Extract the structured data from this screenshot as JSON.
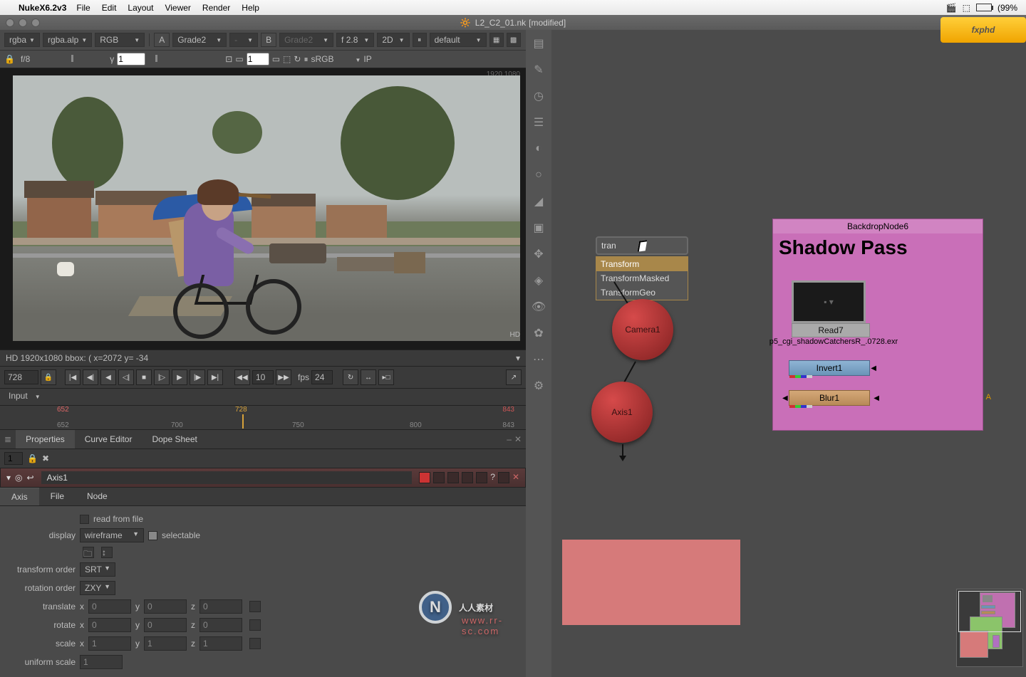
{
  "menubar": {
    "appname": "NukeX6.2v3",
    "items": [
      "File",
      "Edit",
      "Layout",
      "Viewer",
      "Render",
      "Help"
    ],
    "battery_pct": "(99%"
  },
  "titlebar": {
    "filename": "L2_C2_01.nk",
    "suffix": "[modified]"
  },
  "toolbar1": {
    "channel1": "rgba",
    "channel2": "rgba.alp",
    "rgb": "RGB",
    "a_label": "A",
    "a_value": "Grade2",
    "b_label": "B",
    "b_value": "Grade2",
    "proxy": "f 2.8",
    "dim": "2D",
    "d_value": "default"
  },
  "toolbar2": {
    "fstop_label": "f/8",
    "fstop_val": "",
    "gamma_label": "γ",
    "gamma_val": "1",
    "mid_val": "1",
    "colorspace": "sRGB",
    "ip": "IP"
  },
  "viewer": {
    "res_overlay": "1920,1080",
    "hd_overlay": "HD"
  },
  "statusbar": {
    "text": "HD 1920x1080 bbox: (  x=2072 y= -34"
  },
  "transport": {
    "frame": "728",
    "step": "10",
    "fps_label": "fps",
    "fps": "24",
    "input_dd": "Input"
  },
  "timeline": {
    "start": "652",
    "start_red": "652",
    "ticks": [
      "700",
      "750",
      "800"
    ],
    "cur": "728",
    "end": "843",
    "end_red": "843"
  },
  "proptabs": {
    "tabs": [
      "Properties",
      "Curve Editor",
      "Dope Sheet"
    ]
  },
  "propstrip": {
    "value": "1"
  },
  "nodepanel": {
    "title": "Axis1",
    "tabs": [
      "Axis",
      "File",
      "Node"
    ],
    "read_from_file": "read from file",
    "display_label": "display",
    "display_val": "wireframe",
    "selectable": "selectable",
    "transform_order_label": "transform order",
    "transform_order": "SRT",
    "rotation_order_label": "rotation order",
    "rotation_order": "ZXY",
    "translate_label": "translate",
    "rotate_label": "rotate",
    "scale_label": "scale",
    "uniform_scale_label": "uniform scale",
    "x": "x",
    "y": "y",
    "z": "z",
    "t_x": "0",
    "t_y": "0",
    "t_z": "0",
    "r_x": "0",
    "r_y": "0",
    "r_z": "0",
    "s_x": "1",
    "s_y": "1",
    "s_z": "1",
    "us": "1"
  },
  "tabpopup": {
    "query": "tran",
    "options": [
      "Transform",
      "TransformMasked",
      "TransformGeo"
    ]
  },
  "nodes": {
    "camera": "Camera1",
    "axis": "Axis1"
  },
  "backdrop": {
    "title": "BackdropNode6",
    "heading": "Shadow Pass",
    "read": "Read7",
    "file": "p5_cgi_shadowCatchersR_.0728.exr",
    "invert": "Invert1",
    "blur": "Blur1",
    "arrow_a": "A"
  },
  "brand": "fxphd",
  "wm_text": "人人素材",
  "wm_url": "www.rr-sc.com"
}
